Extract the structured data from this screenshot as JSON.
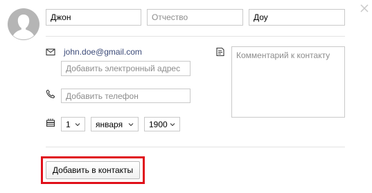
{
  "contact": {
    "first_name": "Джон",
    "middle_name_placeholder": "Отчество",
    "last_name": "Доу",
    "email": "john.doe@gmail.com",
    "add_email_placeholder": "Добавить электронный адрес",
    "add_phone_placeholder": "Добавить телефон",
    "comment_placeholder": "Комментарий к контакту",
    "birthday": {
      "day": "1",
      "month": "января",
      "year": "1900"
    }
  },
  "actions": {
    "add_contact_label": "Добавить в контакты"
  },
  "colors": {
    "highlight": "#e0101a",
    "email_link": "#3b4a78",
    "border": "#c9c9c9"
  },
  "icons": {
    "avatar": "avatar-silhouette-icon",
    "close": "close-icon",
    "email": "envelope-icon",
    "phone": "phone-icon",
    "birthday": "cake-icon",
    "comment": "note-icon",
    "chevron": "chevron-down-icon"
  }
}
